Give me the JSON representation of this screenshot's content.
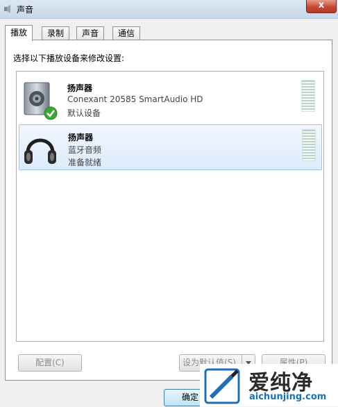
{
  "window": {
    "title": "声音",
    "close_label": "x"
  },
  "tabs": [
    {
      "label": "播放",
      "active": true
    },
    {
      "label": "录制",
      "active": false
    },
    {
      "label": "声音",
      "active": false
    },
    {
      "label": "通信",
      "active": false
    }
  ],
  "instruction": "选择以下播放设备来修改设置:",
  "devices": [
    {
      "name": "扬声器",
      "description": "Conexant 20585 SmartAudio HD",
      "status": "默认设备",
      "icon": "speaker-icon",
      "default": true,
      "selected": false
    },
    {
      "name": "扬声器",
      "description": "蓝牙音频",
      "status": "准备就绪",
      "icon": "headphones-icon",
      "default": false,
      "selected": true
    }
  ],
  "buttons": {
    "configure": "配置(C)",
    "set_default": "设为默认值(S)",
    "properties": "属性(P)",
    "ok": "确定"
  },
  "watermark": {
    "title": "爱纯净",
    "url": "aichunjing.com"
  },
  "colors": {
    "selection_bg": "#dcebfc",
    "check_green": "#3fa535",
    "url_blue": "#1d6fb5"
  }
}
